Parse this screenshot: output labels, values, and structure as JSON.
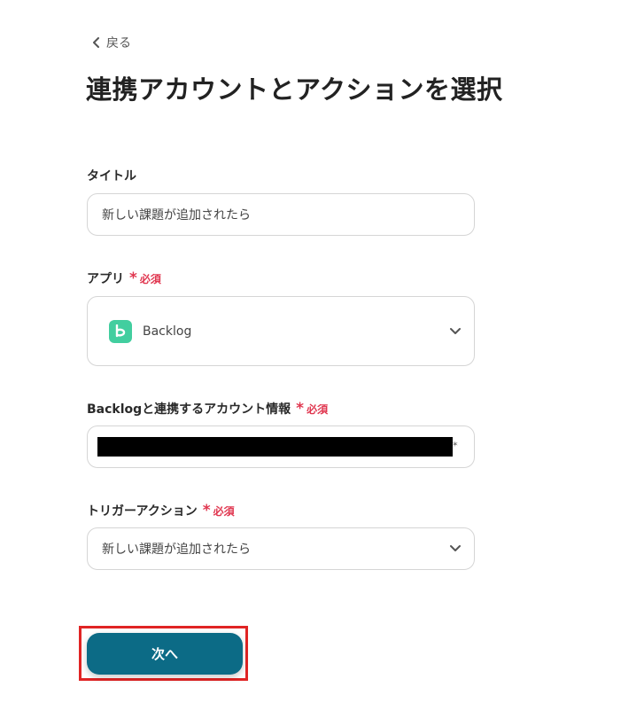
{
  "header": {
    "back_label": "戻る",
    "title": "連携アカウントとアクションを選択"
  },
  "form": {
    "title_field": {
      "label": "タイトル",
      "value": "新しい課題が追加されたら"
    },
    "app_field": {
      "label": "アプリ",
      "required_label": "必須",
      "selected": "Backlog",
      "icon": "backlog-logo-icon"
    },
    "account_field": {
      "label": "Backlogと連携するアカウント情報",
      "required_label": "必須",
      "value_redacted": true
    },
    "trigger_field": {
      "label": "トリガーアクション",
      "required_label": "必須",
      "selected": "新しい課題が追加されたら"
    },
    "required_mark": "*"
  },
  "actions": {
    "next_label": "次へ"
  },
  "colors": {
    "primary_button": "#0c6b86",
    "required": "#e0364f",
    "backlog_green": "#42ce9f",
    "highlight": "#e02424"
  }
}
